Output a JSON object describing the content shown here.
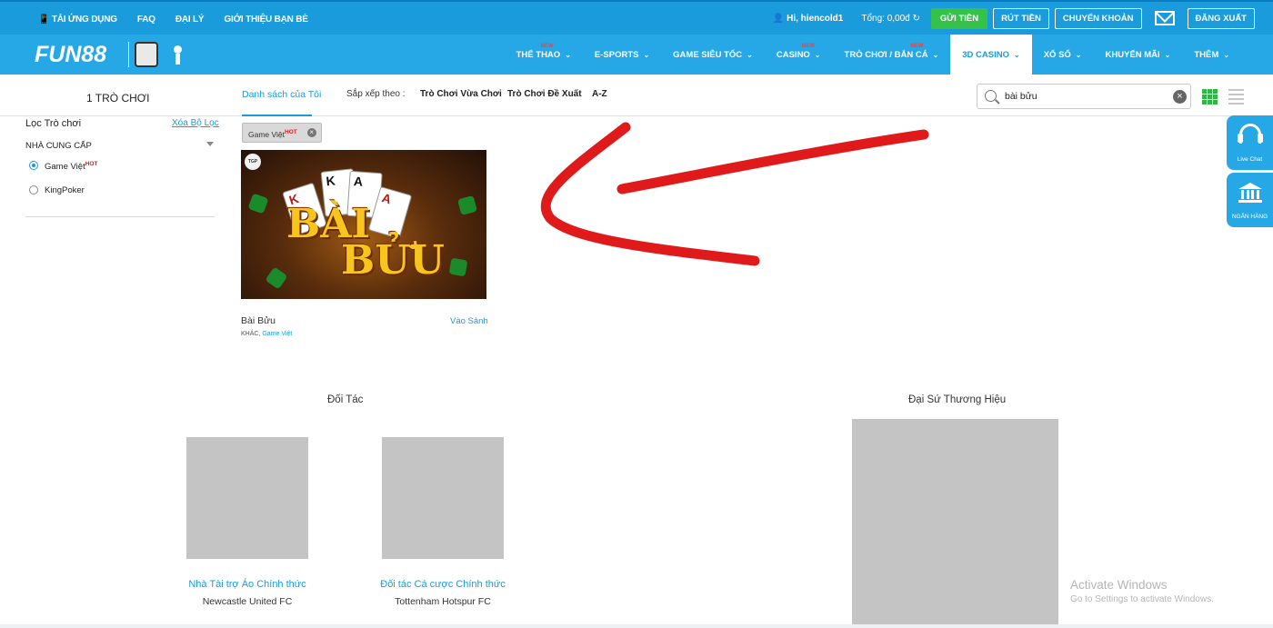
{
  "topbar": {
    "app_download": "TẢI ỨNG DỤNG",
    "faq": "FAQ",
    "agent": "ĐẠI LÝ",
    "refer": "GIỚI THIỆU BẠN BÈ",
    "greeting": "Hi, hiencold1",
    "balance": "Tổng: 0,00đ",
    "deposit": "GỬI TIỀN",
    "withdraw": "RÚT TIỀN",
    "transfer": "CHUYỂN KHOẢN",
    "logout": "ĐĂNG XUẤT"
  },
  "brand": {
    "logo": "FUN88"
  },
  "nav": [
    {
      "label": "THỂ THAO",
      "badge": "NEW"
    },
    {
      "label": "E-SPORTS",
      "badge": ""
    },
    {
      "label": "GAME SIÊU TỐC",
      "badge": ""
    },
    {
      "label": "CASINO",
      "badge": "NEW"
    },
    {
      "label": "TRÒ CHƠI / BẮN CÁ",
      "badge": "NEW"
    },
    {
      "label": "3D CASINO",
      "badge": ""
    },
    {
      "label": "XỔ SỐ",
      "badge": ""
    },
    {
      "label": "KHUYẾN MÃI",
      "badge": ""
    },
    {
      "label": "THÊM",
      "badge": ""
    }
  ],
  "subbar": {
    "game_count": "1 TRÒ CHƠI",
    "my_list": "Danh sách của Tôi",
    "sort_label": "Sắp xếp theo :",
    "sort_recent": "Trò Chơi Vừa Chơi",
    "sort_recommended": "Trò Chơi Đề Xuất",
    "sort_az": "A-Z"
  },
  "search": {
    "value": "bài bửu"
  },
  "filters": {
    "title": "Lọc Trò chơi",
    "clear": "Xóa Bộ Lọc",
    "provider_title": "NHÀ CUNG CẤP",
    "providers": [
      {
        "label": "Game Việt",
        "badge": "HOT",
        "selected": true
      },
      {
        "label": "KingPoker",
        "badge": "",
        "selected": false
      }
    ],
    "active_chip": {
      "label": "Game Việt",
      "badge": "HOT"
    }
  },
  "game": {
    "provider_badge": "TGP",
    "logo_line1": "BÀI",
    "logo_line2": "BỬU",
    "card1": "K",
    "card2": "K",
    "card3": "A",
    "card4": "A",
    "name": "Bài Bửu",
    "action": "Vào Sảnh",
    "category": "KHÁC,",
    "provider": "Game Việt"
  },
  "footer": {
    "partners_title": "Đối Tác",
    "ambassador_title": "Đại Sứ Thương Hiệu",
    "partners": [
      {
        "title": "Nhà Tài trợ Áo Chính thức",
        "sub": "Newcastle United FC"
      },
      {
        "title": "Đối tác Cá cược Chính thức",
        "sub": "Tottenham Hotspur FC"
      }
    ]
  },
  "side": {
    "live_chat": "Live Chat",
    "bank": "NGÂN HÀNG"
  },
  "watermark": {
    "line1": "Activate Windows",
    "line2": "Go to Settings to activate Windows."
  },
  "colors": {
    "primary": "#26a8e6",
    "topbar": "#1a9bdc",
    "green": "#35c24a",
    "annotation_red": "#e01a1a"
  }
}
